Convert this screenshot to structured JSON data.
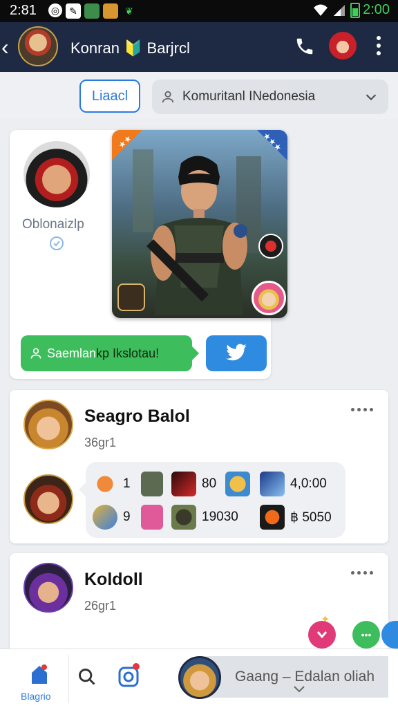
{
  "status_bar": {
    "time": "2:81",
    "battery": "2:00"
  },
  "header": {
    "title": "Konran 🔰 Barjrcl"
  },
  "filter": {
    "chip_label": "Liaacl",
    "dropdown_value": "Komuritanl INedonesia"
  },
  "feature": {
    "profile_name": "Oblonaizlp",
    "corner_left": "★★",
    "corner_right": "★★★",
    "cta_label_a": "Saemlan ",
    "cta_label_b": "kp Ikslotau!"
  },
  "posts": [
    {
      "name": "Seagro Balol",
      "sub": "36gr1",
      "stats": [
        {
          "value": "1",
          "icon": "fox-icon"
        },
        {
          "value": "80",
          "icon": "sword-icon"
        },
        {
          "value": "4,0:00",
          "icon": "hero-icon"
        },
        {
          "value": "9",
          "icon": "gift-icon"
        },
        {
          "value": "19030",
          "icon": "soldier-icon"
        },
        {
          "value": "฿ 5050",
          "icon": "fire-icon"
        }
      ]
    },
    {
      "name": "Koldoll",
      "sub": "26gr1"
    }
  ],
  "bottom_nav": {
    "home_label": "Blagrio",
    "compose_text": "Gaang – Edalan oliah"
  },
  "colors": {
    "header_bg": "#1e2a44",
    "accent_blue": "#2b7be0",
    "green": "#3ebd5c",
    "pink": "#e03a78"
  }
}
